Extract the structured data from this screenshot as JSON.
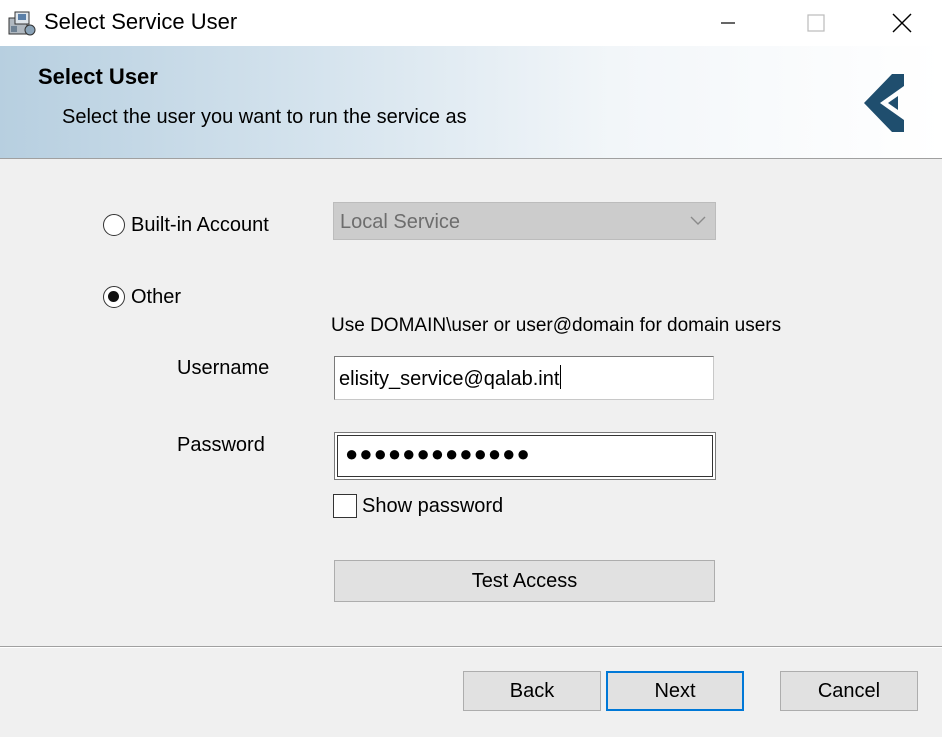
{
  "window": {
    "title": "Select Service User"
  },
  "banner": {
    "title": "Select User",
    "subtitle": "Select the user you want to run the service as",
    "logo_color": "#1f4e6e"
  },
  "account": {
    "builtin_label": "Built-in Account",
    "builtin_selected": false,
    "builtin_value": "Local Service",
    "other_label": "Other",
    "other_selected": true,
    "hint": "Use DOMAIN\\user or user@domain for domain users"
  },
  "form": {
    "username_label": "Username",
    "username_value": "elisity_service@qalab.int",
    "password_label": "Password",
    "password_mask": "●●●●●●●●●●●●●",
    "show_password_label": "Show password",
    "show_password_checked": false,
    "test_access_label": "Test Access"
  },
  "footer": {
    "back_label": "Back",
    "next_label": "Next",
    "cancel_label": "Cancel",
    "focus_color": "#0078d7"
  }
}
